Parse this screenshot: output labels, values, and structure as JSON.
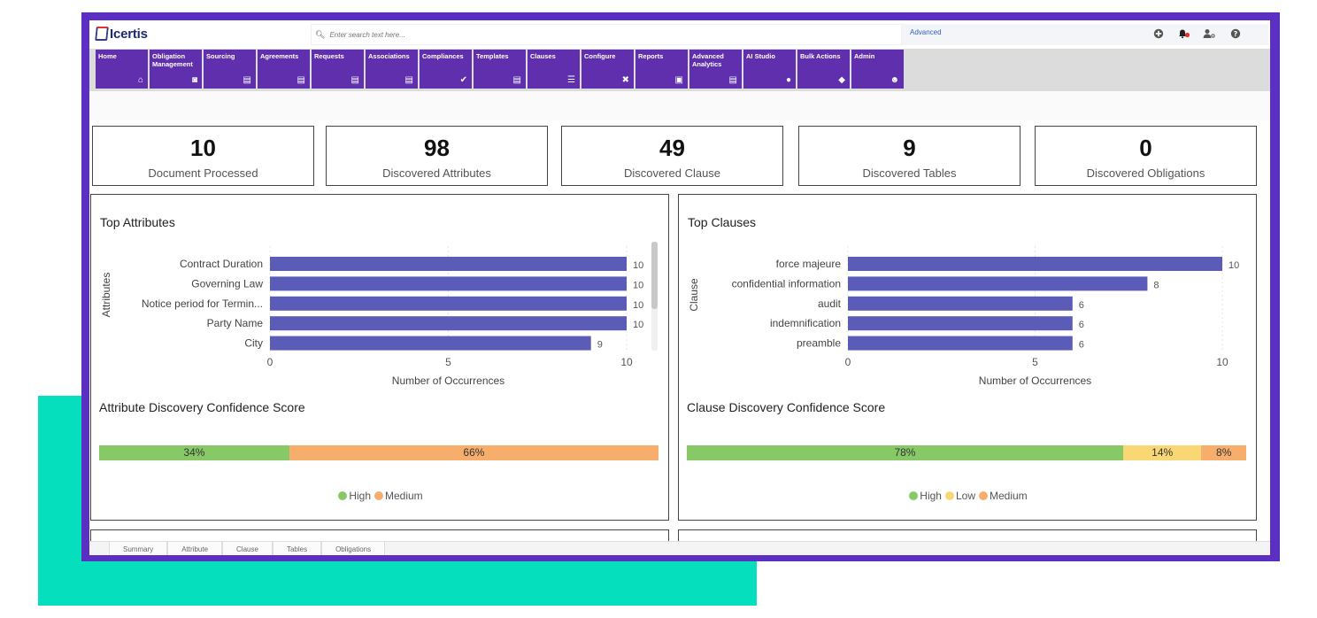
{
  "header": {
    "logo_text": "Icertis",
    "search_placeholder": "Enter search text here...",
    "advanced_label": "Advanced",
    "icons": [
      "add-circle-icon",
      "notification-bell-icon",
      "user-settings-icon",
      "help-icon"
    ]
  },
  "nav": {
    "items": [
      {
        "label": "Home",
        "icon": "home-icon",
        "glyph": "⌂"
      },
      {
        "label": "Obligation Management",
        "icon": "handshake-icon",
        "glyph": "◙"
      },
      {
        "label": "Sourcing",
        "icon": "document-icon",
        "glyph": "▤"
      },
      {
        "label": "Agreements",
        "icon": "document-icon",
        "glyph": "▤"
      },
      {
        "label": "Requests",
        "icon": "document-icon",
        "glyph": "▤"
      },
      {
        "label": "Associations",
        "icon": "document-icon",
        "glyph": "▤"
      },
      {
        "label": "Compliances",
        "icon": "check-icon",
        "glyph": "✔"
      },
      {
        "label": "Templates",
        "icon": "document-icon",
        "glyph": "▤"
      },
      {
        "label": "Clauses",
        "icon": "list-icon",
        "glyph": "☰"
      },
      {
        "label": "Configure",
        "icon": "tools-icon",
        "glyph": "✖"
      },
      {
        "label": "Reports",
        "icon": "clipboard-icon",
        "glyph": "▣"
      },
      {
        "label": "Advanced Analytics",
        "icon": "document-icon",
        "glyph": "▤"
      },
      {
        "label": "AI Studio",
        "icon": "lightbulb-icon",
        "glyph": "●"
      },
      {
        "label": "Bulk Actions",
        "icon": "layers-icon",
        "glyph": "◆"
      },
      {
        "label": "Admin",
        "icon": "users-admin-icon",
        "glyph": "☻"
      }
    ]
  },
  "stats": [
    {
      "value": "10",
      "label": "Document Processed"
    },
    {
      "value": "98",
      "label": "Discovered Attributes"
    },
    {
      "value": "49",
      "label": "Discovered Clause"
    },
    {
      "value": "9",
      "label": "Discovered Tables"
    },
    {
      "value": "0",
      "label": "Discovered Obligations"
    }
  ],
  "attributes_panel": {
    "title": "Top Attributes",
    "confidence_title": "Attribute Discovery Confidence Score"
  },
  "clauses_panel": {
    "title": "Top Clauses",
    "confidence_title": "Clause Discovery Confidence Score"
  },
  "chart_data": [
    {
      "type": "bar",
      "orientation": "horizontal",
      "title": "Top Attributes",
      "categories": [
        "Contract Duration",
        "Governing Law",
        "Notice period for Termin...",
        "Party Name",
        "City"
      ],
      "values": [
        10,
        10,
        10,
        10,
        9
      ],
      "xlabel": "Number of Occurrences",
      "ylabel": "Attributes",
      "xlim": [
        0,
        10
      ],
      "xticks": [
        0,
        5,
        10
      ],
      "color": "#5b5bb8"
    },
    {
      "type": "bar",
      "orientation": "horizontal",
      "title": "Top Clauses",
      "categories": [
        "force majeure",
        "confidential information",
        "audit",
        "indemnification",
        "preamble"
      ],
      "values": [
        10,
        8,
        6,
        6,
        6
      ],
      "xlabel": "Number of Occurrences",
      "ylabel": "Clause",
      "xlim": [
        0,
        10
      ],
      "xticks": [
        0,
        5,
        10
      ],
      "color": "#5b5bb8"
    },
    {
      "type": "bar",
      "orientation": "stacked-horizontal",
      "title": "Attribute Discovery Confidence Score",
      "series": [
        {
          "name": "High",
          "value": 34,
          "label": "34%",
          "color": "#88c967"
        },
        {
          "name": "Medium",
          "value": 66,
          "label": "66%",
          "color": "#f7ad6c"
        }
      ]
    },
    {
      "type": "bar",
      "orientation": "stacked-horizontal",
      "title": "Clause Discovery Confidence Score",
      "series": [
        {
          "name": "High",
          "value": 78,
          "label": "78%",
          "color": "#88c967"
        },
        {
          "name": "Low",
          "value": 14,
          "label": "14%",
          "color": "#f8d774"
        },
        {
          "name": "Medium",
          "value": 8,
          "label": "8%",
          "color": "#f7ad6c"
        }
      ]
    }
  ],
  "bottom": {
    "tabs": [
      "Summary",
      "Attribute",
      "Clause",
      "Tables",
      "Obligations"
    ]
  }
}
